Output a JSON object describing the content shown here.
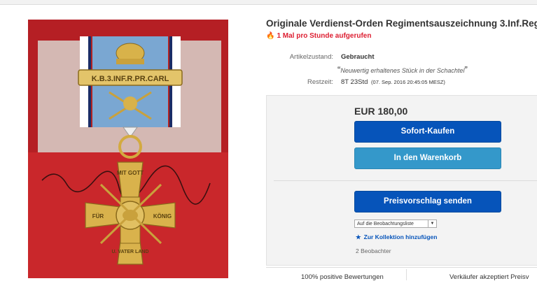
{
  "listing": {
    "title": "Originale Verdienst-Orden Regimentsauszeichnung 3.Inf.Reg.",
    "watchers": "1 Mal pro Stunde aufgerufen"
  },
  "details": {
    "condition_label": "Artikelzustand:",
    "condition_value": "Gebraucht",
    "condition_note": "Neuwertig erhaltenes Stück in der Schachtel",
    "time_label": "Restzeit:",
    "time_value": "8T 23Std",
    "time_end": "(07. Sep. 2016   20:45:05 MESZ)"
  },
  "buybox": {
    "price": "EUR 180,00",
    "buy_now": "Sofort-Kaufen",
    "add_to_cart": "In den Warenkorb",
    "make_offer": "Preisvorschlag senden",
    "watchlist_select": "Auf die Beobachtungsliste",
    "add_collection": "Zur Kollektion hinzufügen",
    "watch_count": "2 Beobachter"
  },
  "bottom": {
    "feedback": "100% positive Bewertungen",
    "seller_accepts": "Verkäufer akzeptiert Preisv"
  },
  "photo": {
    "bar_text": "K.B.3.INF.R.PR.CARL",
    "medal_text_top": "MIT GOTT",
    "medal_text_left": "FÜR",
    "medal_text_right": "KÖNIG",
    "medal_text_bottom": "U. VATER LAND"
  },
  "colors": {
    "price_text": "#333333",
    "button_primary": "#0654ba",
    "button_secondary": "#3498ca",
    "alert_red": "#dd1e31",
    "box_red": "#c9272b"
  },
  "icons": {
    "watchers": "flame-icon",
    "collection": "star-icon",
    "dropdown": "chevron-down-icon"
  }
}
